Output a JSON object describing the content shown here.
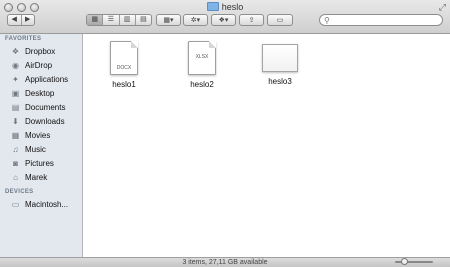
{
  "window": {
    "title": "heslo"
  },
  "toolbar": {
    "back_icon": "chevron-left-icon",
    "forward_icon": "chevron-right-icon",
    "view_modes": [
      "icon-view-icon",
      "list-view-icon",
      "column-view-icon",
      "cover-flow-icon"
    ],
    "arrange_icon": "arrange-grid-icon",
    "action_icon": "gear-icon",
    "dropbox_icon": "dropbox-icon",
    "share_icon": "share-icon",
    "tags_icon": "tag-icon",
    "search": {
      "placeholder": "",
      "icon": "search-icon"
    }
  },
  "sidebar": {
    "sections": [
      {
        "title": "FAVORITES",
        "items": [
          {
            "label": "Dropbox",
            "icon": "dropbox-icon"
          },
          {
            "label": "AirDrop",
            "icon": "airdrop-icon"
          },
          {
            "label": "Applications",
            "icon": "applications-icon"
          },
          {
            "label": "Desktop",
            "icon": "desktop-icon"
          },
          {
            "label": "Documents",
            "icon": "documents-icon"
          },
          {
            "label": "Downloads",
            "icon": "downloads-icon"
          },
          {
            "label": "Movies",
            "icon": "movies-icon"
          },
          {
            "label": "Music",
            "icon": "music-icon"
          },
          {
            "label": "Pictures",
            "icon": "pictures-icon"
          },
          {
            "label": "Marek",
            "icon": "home-icon"
          }
        ]
      },
      {
        "title": "DEVICES",
        "items": [
          {
            "label": "Macintosh...",
            "icon": "disk-icon"
          }
        ]
      }
    ]
  },
  "files": [
    {
      "name": "heslo1",
      "kind": "DOCX"
    },
    {
      "name": "heslo2",
      "kind": "XLSX"
    },
    {
      "name": "heslo3",
      "kind": ""
    }
  ],
  "status": {
    "text": "3 items, 27,11 GB available",
    "zoom_level": 0.2
  },
  "colors": {
    "sidebar_bg": "#e3e8ee",
    "folder_blue": "#7fb2e5"
  }
}
